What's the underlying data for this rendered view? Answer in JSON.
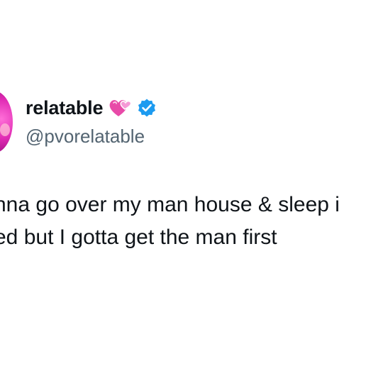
{
  "account": {
    "display_name": "relatable",
    "handle": "@pvorelatable",
    "name_emoji_icon": "two-hearts-icon",
    "verified_icon": "verified-badge-icon",
    "brand_color": "#1d9bf0"
  },
  "tweet": {
    "lines": [
      "nna go over my man house & sleep i",
      "ed but I gotta get the man first"
    ]
  }
}
